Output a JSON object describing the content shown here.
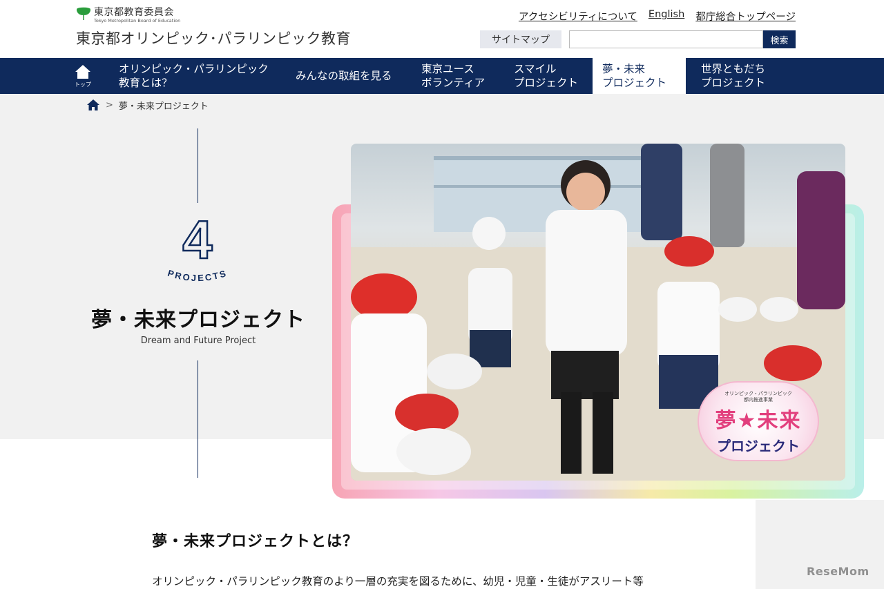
{
  "header": {
    "org_name_ja": "東京都教育委員会",
    "org_name_en": "Tokyo Metropolitan Board of Education",
    "site_title": "東京都オリンピック･パラリンピック教育",
    "util_links": [
      "アクセシビリティについて",
      "English",
      "都庁総合トップページ"
    ],
    "sitemap_label": "サイトマップ",
    "search_placeholder": "",
    "search_button": "検索"
  },
  "nav": {
    "home_label": "トップ",
    "items": [
      {
        "line1": "オリンピック・パラリンピック",
        "line2": "教育とは？"
      },
      {
        "line1": "みんなの取組を見る",
        "line2": ""
      },
      {
        "line1": "東京ユース",
        "line2": "ボランティア"
      },
      {
        "line1": "スマイル",
        "line2": "プロジェクト"
      },
      {
        "line1": "夢・未来",
        "line2": "プロジェクト"
      },
      {
        "line1": "世界ともだち",
        "line2": "プロジェクト"
      }
    ],
    "active_index": 4
  },
  "breadcrumb": {
    "separator": ">",
    "current": "夢・未来プロジェクト"
  },
  "hero": {
    "project_number": "4",
    "projects_label": "PROJECTS",
    "title": "夢・未来プロジェクト",
    "subtitle": "Dream and Future Project",
    "badge_top_line1": "オリンピック・パラリンピック",
    "badge_top_line2": "都内推進事業",
    "badge_main": "夢★未来",
    "badge_sub": "プロジェクト"
  },
  "content": {
    "heading": "夢・未来プロジェクトとは？",
    "paragraph": "オリンピック・パラリンピック教育のより一層の充実を図るために、幼児・児童・生徒がアスリート等"
  },
  "watermark": "ReseMom",
  "colors": {
    "navy": "#0f2a5c",
    "hero_bg": "#f1f1f1",
    "badge_pink": "#e23f7d"
  }
}
